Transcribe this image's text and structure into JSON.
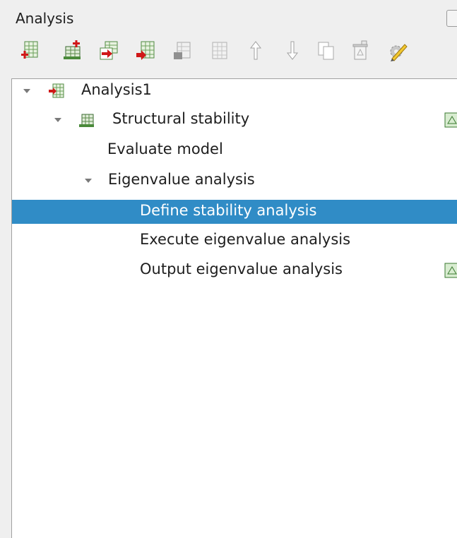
{
  "panel": {
    "title": "Analysis"
  },
  "toolbar": {
    "icons": [
      "new-analysis-icon",
      "add-analysis-step-icon",
      "insert-analysis-step-icon",
      "add-analysis-item-icon",
      "analysis-item-disabled-icon",
      "grid-disabled-icon",
      "move-up-icon",
      "move-down-icon",
      "copy-icon",
      "delete-icon",
      "edit-settings-icon"
    ]
  },
  "tree": {
    "analysis": {
      "label": "Analysis1"
    },
    "step": {
      "label": "Structural stability"
    },
    "evaluate": {
      "label": "Evaluate model"
    },
    "eigen": {
      "label": "Eigenvalue analysis"
    },
    "define": {
      "label": "Define stability analysis",
      "selected": true
    },
    "execute": {
      "label": "Execute eigenvalue analysis"
    },
    "output": {
      "label": "Output eigenvalue analysis"
    }
  },
  "colors": {
    "selection": "#308cc6",
    "accent_red": "#d01818",
    "accent_green": "#3a8a3a"
  }
}
